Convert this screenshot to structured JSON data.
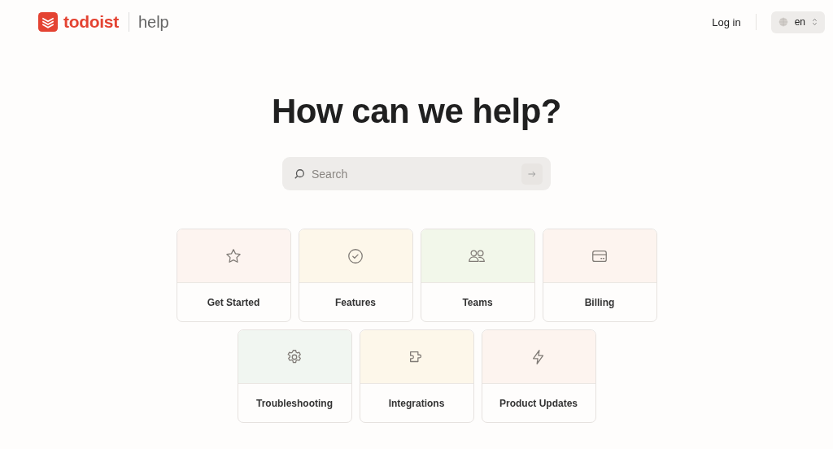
{
  "header": {
    "brand": "todoist",
    "section": "help",
    "login": "Log in",
    "language": "en"
  },
  "headline": "How can we help?",
  "search": {
    "placeholder": "Search"
  },
  "categories": [
    [
      {
        "label": "Get Started",
        "kind": "star",
        "color": "#fdf4f0"
      },
      {
        "label": "Features",
        "kind": "check",
        "color": "#fdf7ea"
      },
      {
        "label": "Teams",
        "kind": "people",
        "color": "#f2f7ea"
      },
      {
        "label": "Billing",
        "kind": "card",
        "color": "#fdf4ef"
      }
    ],
    [
      {
        "label": "Troubleshooting",
        "kind": "gear",
        "color": "#f1f6f1"
      },
      {
        "label": "Integrations",
        "kind": "puzzle",
        "color": "#fdf7ea"
      },
      {
        "label": "Product Updates",
        "kind": "bolt",
        "color": "#fdf4ef"
      }
    ]
  ]
}
